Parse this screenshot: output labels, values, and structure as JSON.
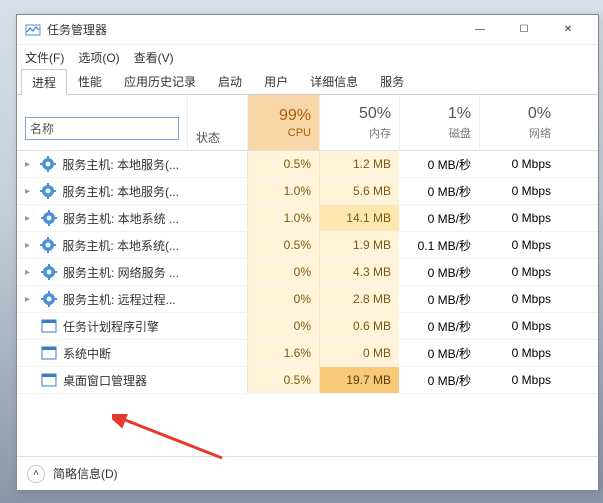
{
  "window": {
    "title": "任务管理器",
    "minimize": "—",
    "maximize": "☐",
    "close": "✕"
  },
  "menu": {
    "file": "文件(F)",
    "options": "选项(O)",
    "view": "查看(V)"
  },
  "tabs": [
    "进程",
    "性能",
    "应用历史记录",
    "启动",
    "用户",
    "详细信息",
    "服务"
  ],
  "active_tab": 0,
  "columns": {
    "name": "名称",
    "status": "状态",
    "cpu": {
      "pct": "99%",
      "label": "CPU"
    },
    "memory": {
      "pct": "50%",
      "label": "内存"
    },
    "disk": {
      "pct": "1%",
      "label": "磁盘"
    },
    "network": {
      "pct": "0%",
      "label": "网络"
    }
  },
  "processes": [
    {
      "icon": "gear",
      "name": "服务主机: 本地服务(...",
      "cpu": "0.5%",
      "mem": "1.2 MB",
      "disk": "0 MB/秒",
      "net": "0 Mbps",
      "expandable": true,
      "cpu_heat": "l",
      "mem_heat": "l"
    },
    {
      "icon": "gear",
      "name": "服务主机: 本地服务(...",
      "cpu": "1.0%",
      "mem": "5.6 MB",
      "disk": "0 MB/秒",
      "net": "0 Mbps",
      "expandable": true,
      "cpu_heat": "l",
      "mem_heat": "l"
    },
    {
      "icon": "gear",
      "name": "服务主机: 本地系统 ...",
      "cpu": "1.0%",
      "mem": "14.1 MB",
      "disk": "0 MB/秒",
      "net": "0 Mbps",
      "expandable": true,
      "cpu_heat": "l",
      "mem_heat": "m"
    },
    {
      "icon": "gear",
      "name": "服务主机: 本地系统(...",
      "cpu": "0.5%",
      "mem": "1.9 MB",
      "disk": "0.1 MB/秒",
      "net": "0 Mbps",
      "expandable": true,
      "cpu_heat": "l",
      "mem_heat": "l"
    },
    {
      "icon": "gear",
      "name": "服务主机: 网络服务 ...",
      "cpu": "0%",
      "mem": "4.3 MB",
      "disk": "0 MB/秒",
      "net": "0 Mbps",
      "expandable": true,
      "cpu_heat": "l",
      "mem_heat": "l"
    },
    {
      "icon": "gear",
      "name": "服务主机: 远程过程...",
      "cpu": "0%",
      "mem": "2.8 MB",
      "disk": "0 MB/秒",
      "net": "0 Mbps",
      "expandable": true,
      "cpu_heat": "l",
      "mem_heat": "l"
    },
    {
      "icon": "app",
      "name": "任务计划程序引擎",
      "cpu": "0%",
      "mem": "0.6 MB",
      "disk": "0 MB/秒",
      "net": "0 Mbps",
      "expandable": false,
      "cpu_heat": "l",
      "mem_heat": "l"
    },
    {
      "icon": "app",
      "name": "系统中断",
      "cpu": "1.6%",
      "mem": "0 MB",
      "disk": "0 MB/秒",
      "net": "0 Mbps",
      "expandable": false,
      "cpu_heat": "l",
      "mem_heat": "l"
    },
    {
      "icon": "app",
      "name": "桌面窗口管理器",
      "cpu": "0.5%",
      "mem": "19.7 MB",
      "disk": "0 MB/秒",
      "net": "0 Mbps",
      "expandable": false,
      "cpu_heat": "l",
      "mem_heat": "h"
    }
  ],
  "statusbar": {
    "fewer_details": "简略信息(D)"
  }
}
